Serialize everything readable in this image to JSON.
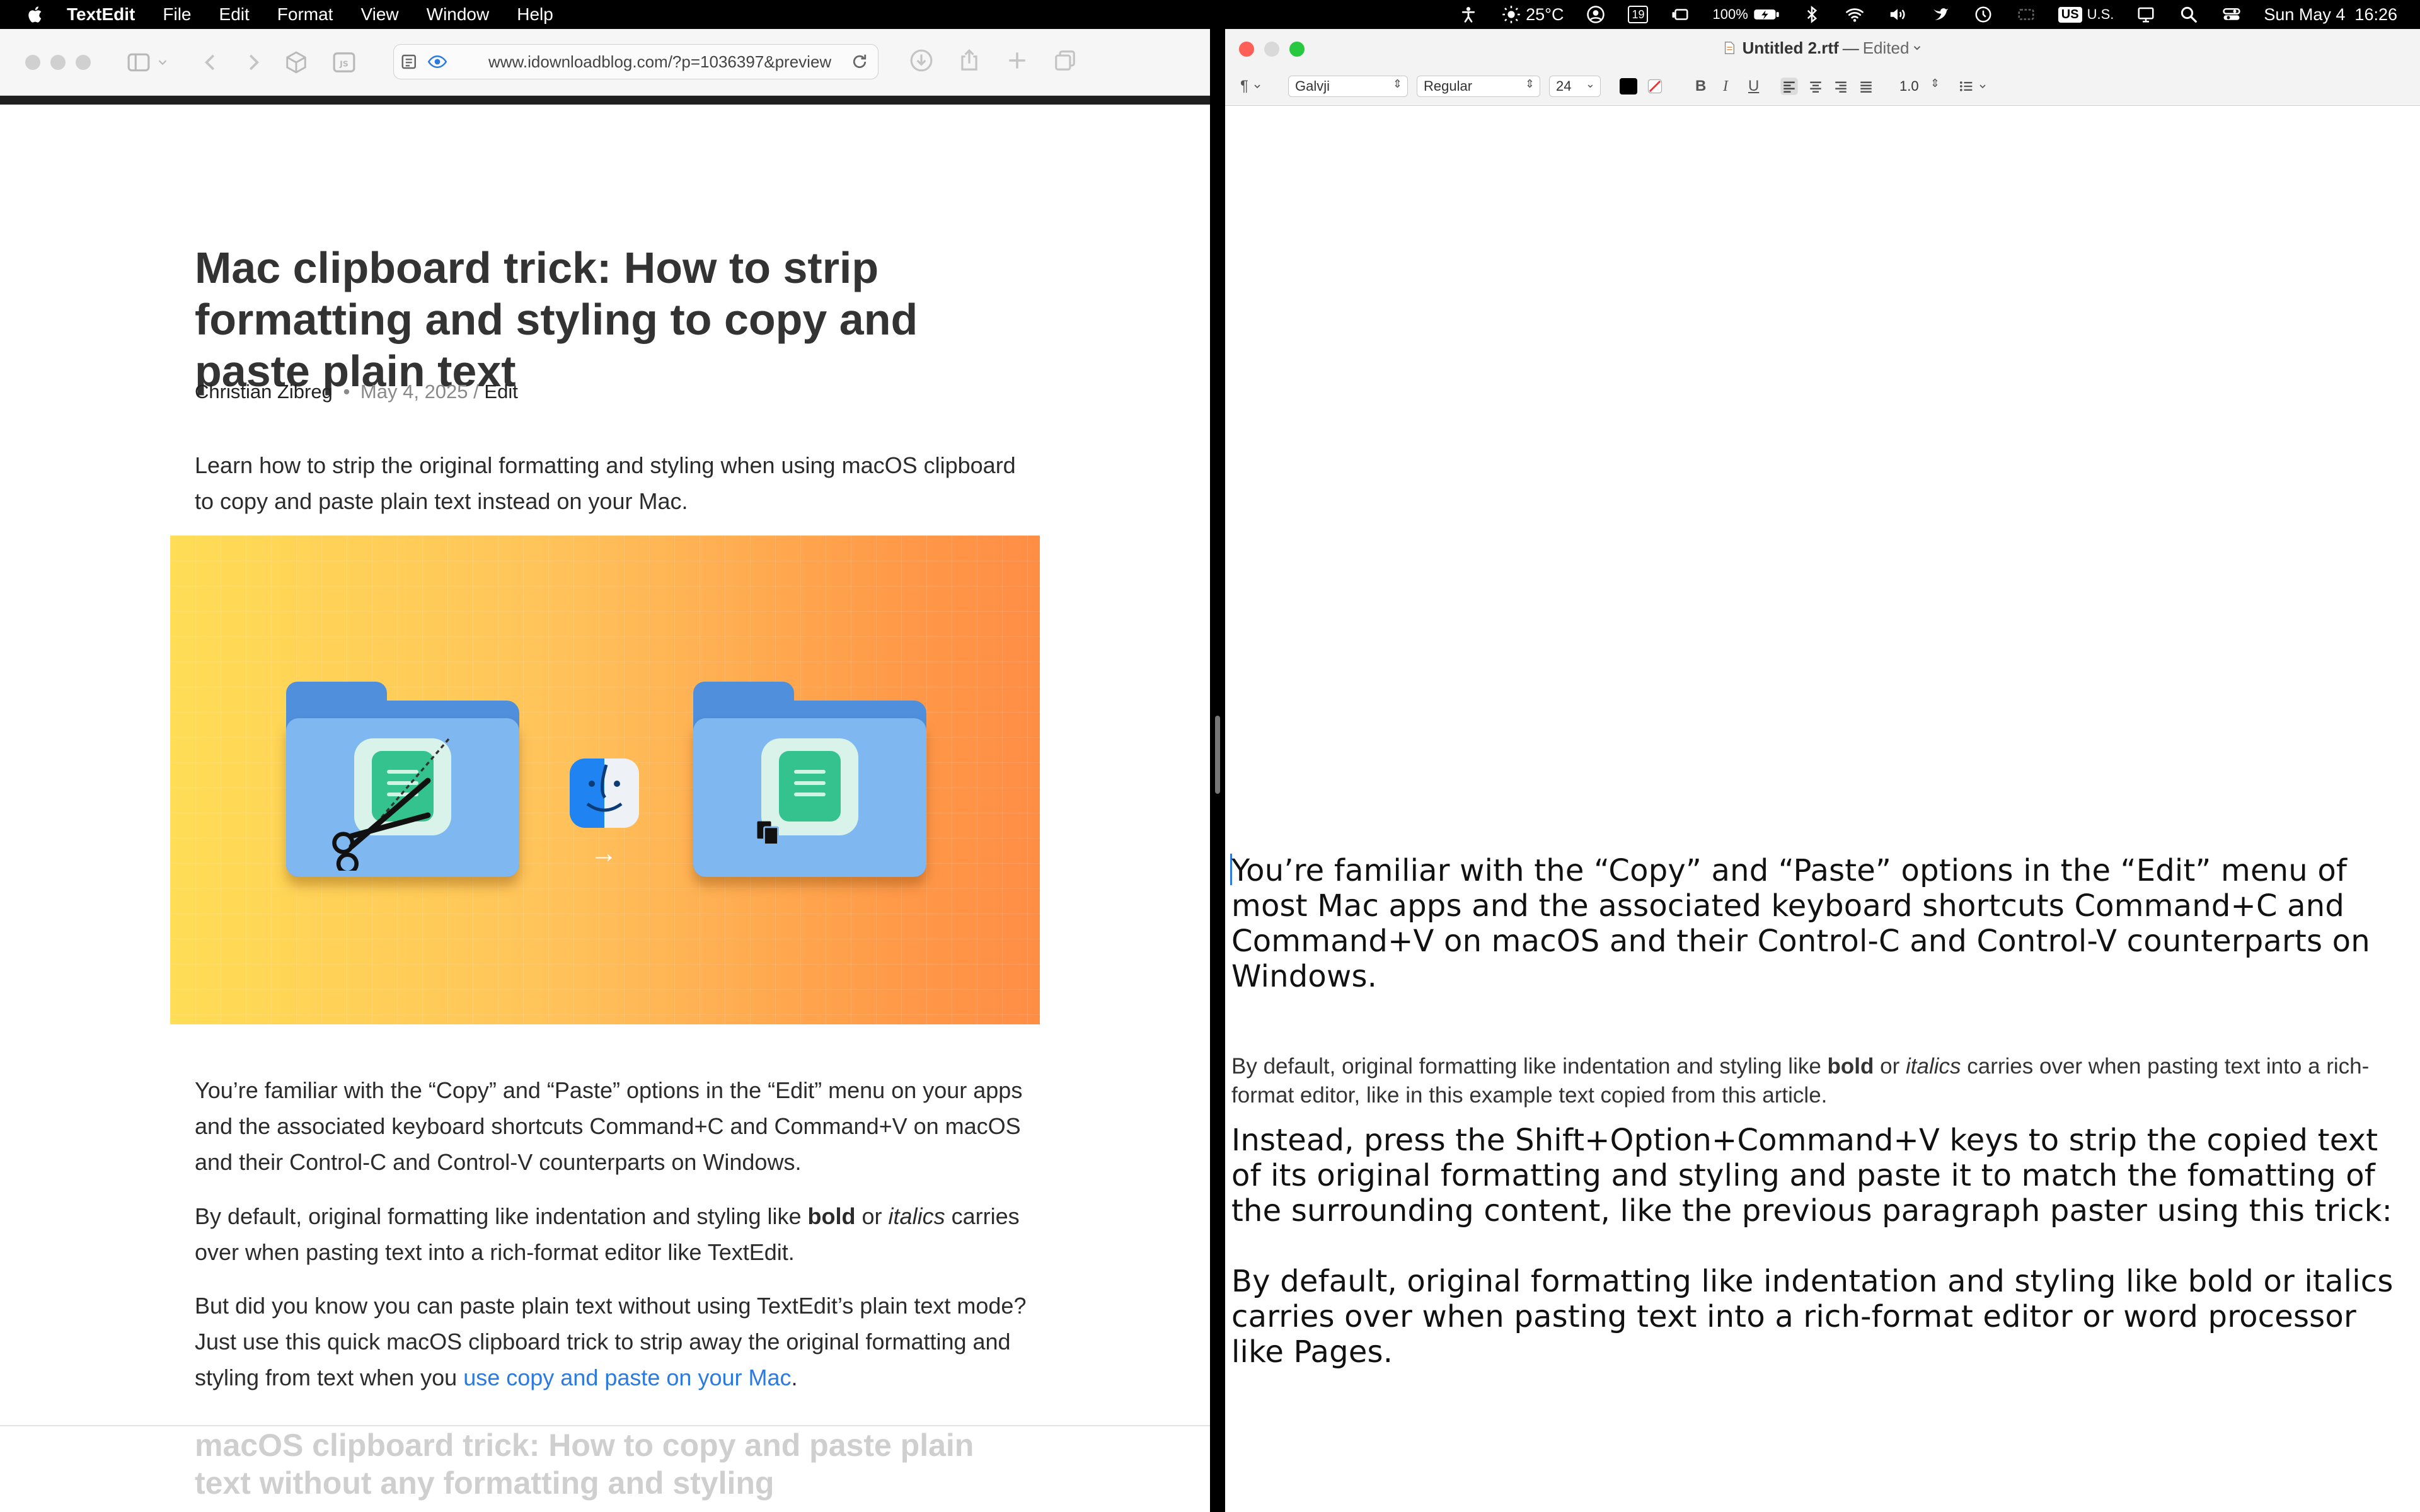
{
  "menubar": {
    "app": "TextEdit",
    "items": [
      "File",
      "Edit",
      "Format",
      "View",
      "Window",
      "Help"
    ],
    "weather": "25°C",
    "calendar_day": "19",
    "battery": "100%",
    "input_source_badge": "US",
    "input_source": "U.S.",
    "datetime": "Sun May 4  16:26"
  },
  "safari": {
    "url": "www.idownloadblog.com/?p=1036397&preview",
    "article": {
      "title": "Mac clipboard trick: How to strip formatting and styling to copy and paste plain text",
      "author": "Christian Zibreg",
      "byline_sep": "•",
      "date": "May 4, 2025",
      "edit_sep": "/",
      "edit_label": "Edit",
      "intro": "Learn how to strip the original formatting and styling when using macOS clipboard to copy and paste plain text instead on your Mac.",
      "p1": "You’re familiar with the “Copy” and “Paste” options in the “Edit” menu on your  apps and the associated keyboard shortcuts Command+C and Command+V on macOS and their Control-C and Control-V counterparts on Windows.",
      "p2_before": "By default, original formatting like indentation and styling like ",
      "p2_bold": "bold",
      "p2_mid": " or ",
      "p2_italic": "italics",
      "p2_after": " carries over when pasting text into a rich-format editor like TextEdit.",
      "p3_before": "But did you know you can paste plain text without using TextEdit’s plain text mode? Just use this quick macOS clipboard trick to strip away the original formatting and styling from text when you ",
      "p3_link": "use copy and paste on your Mac",
      "p3_after": ".",
      "next_heading": "macOS clipboard trick: How to copy and paste plain text without any formatting and styling"
    }
  },
  "textedit": {
    "file_name": "Untitled 2.rtf",
    "title_sep": "—",
    "status": "Edited",
    "toolbar": {
      "paragraph_style": "¶",
      "font_family": "Galvji",
      "font_style": "Regular",
      "font_size": "24",
      "bold": "B",
      "italic": "I",
      "underline": "U",
      "line_spacing": "1.0"
    },
    "document": {
      "p1": "You’re familiar with the “Copy” and “Paste” options in the “Edit” menu of most Mac apps and the associated keyboard shortcuts Command+C and Command+V on macOS and their Control-C and Control-V counterparts on Windows.",
      "p2_before": "By default, original formatting like indentation and styling like ",
      "p2_bold": "bold",
      "p2_mid": " or ",
      "p2_italic": "italics",
      "p2_after": " carries over when pasting text into a rich-format editor, like in this example text copied from this article.",
      "p3": "Instead, press the Shift+Option+Command+V keys to strip the copied text of its original formatting and styling and paste it to match the fomatting of the surrounding content, like the previous paragraph paster using this trick:",
      "p4": "By default, original formatting like indentation and styling like bold or italics carries over when pasting text into a rich-format editor or word processor like Pages."
    }
  },
  "colors": {
    "link": "#2a7ae2",
    "close": "#ff5f57",
    "minimize": "#d9d9d9",
    "zoom": "#28c840"
  }
}
